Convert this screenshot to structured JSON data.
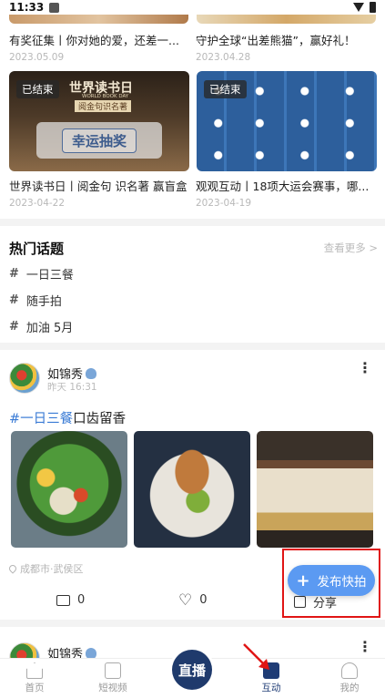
{
  "status_bar": {
    "time": "11:33"
  },
  "top_cards": [
    {
      "title": "有奖征集丨你对她的爱，还差一...",
      "date": "2023.05.09"
    },
    {
      "title": "守护全球“出差熊猫”，赢好礼！",
      "date": "2023.04.28"
    }
  ],
  "activities": [
    {
      "tag": "已结束",
      "banner_text": "世界读书日",
      "banner_sub": "WORLD BOOK DAY",
      "banner_caption": "阅金句识名著",
      "lottery_label": "幸运抽奖",
      "title": "世界读书日丨阅金句 识名著 赢盲盒",
      "date": "2023-04-22"
    },
    {
      "tag": "已结束",
      "title": "观观互动丨18项大运会赛事，哪...",
      "date": "2023-04-19"
    }
  ],
  "hot_topics": {
    "title": "热门话题",
    "more": "查看更多 >",
    "items": [
      "一日三餐",
      "随手拍",
      "加油 5月"
    ]
  },
  "post": {
    "user": "如锦秀",
    "time": "昨天 16:31",
    "hashtag": "#一日三餐",
    "text": "口齿留香",
    "location": "成都市·武侯区",
    "comments": "0",
    "likes": "0",
    "share": "分享"
  },
  "post2": {
    "user": "如锦秀"
  },
  "fab": {
    "label": "发布快拍"
  },
  "bottom_nav": {
    "home": "首页",
    "video": "短视频",
    "live": "直播",
    "interact": "互动",
    "mine": "我的"
  }
}
